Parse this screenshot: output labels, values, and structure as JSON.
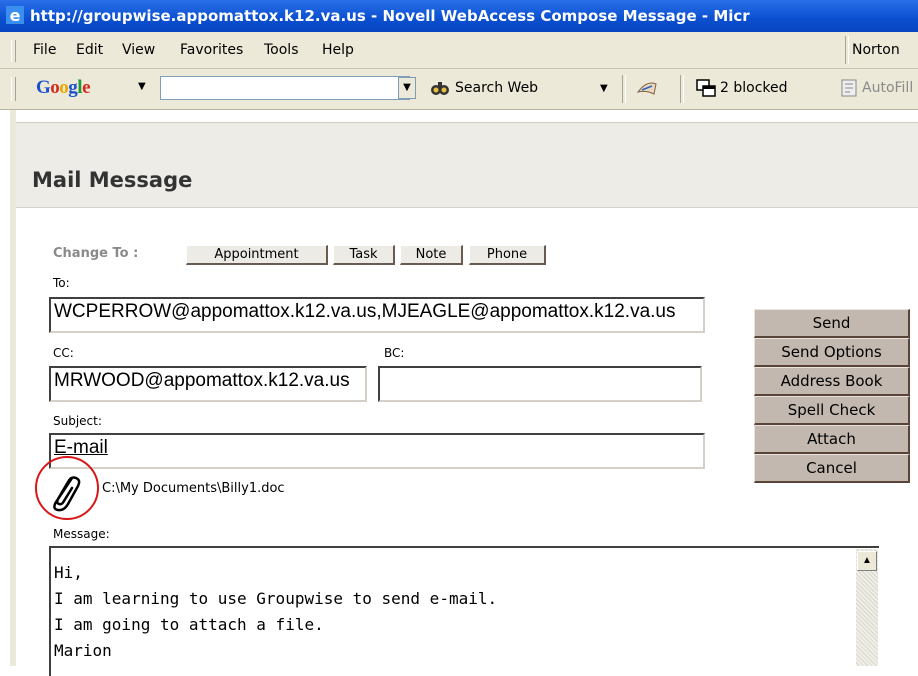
{
  "window": {
    "title": "http://groupwise.appomattox.k12.va.us - Novell WebAccess Compose Message - Micr"
  },
  "menu": {
    "items": [
      "File",
      "Edit",
      "View",
      "Favorites",
      "Tools",
      "Help"
    ],
    "norton": "Norton"
  },
  "google_toolbar": {
    "logo": [
      "G",
      "o",
      "o",
      "g",
      "l",
      "e"
    ],
    "search_value": "",
    "search_web": "Search Web",
    "popups_blocked": "2 blocked",
    "autofill": "AutoFill"
  },
  "page": {
    "title": "Mail Message",
    "change_to_label": "Change To :",
    "change_to_buttons": [
      "Appointment",
      "Task",
      "Note",
      "Phone"
    ]
  },
  "form": {
    "to_label": "To:",
    "to_value": "WCPERROW@appomattox.k12.va.us,MJEAGLE@appomattox.k12.va.us",
    "cc_label": "CC:",
    "cc_value": "MRWOOD@appomattox.k12.va.us",
    "bc_label": "BC:",
    "bc_value": "",
    "subject_label": "Subject:",
    "subject_value": "E-mail",
    "attachment_path": "C:\\My Documents\\Billy1.doc",
    "message_label": "Message:",
    "message_lines": [
      "Hi,",
      "I am learning to use Groupwise to send e-mail.",
      "I am going to attach a file.",
      "Marion"
    ]
  },
  "actions": [
    "Send",
    "Send Options",
    "Address Book",
    "Spell Check",
    "Attach",
    "Cancel"
  ],
  "colors": {
    "titlebar": "#0a4fd0",
    "action_button": "#c2b8b0",
    "highlight_ring": "#d81818"
  },
  "icons": {
    "browser": "ie-icon",
    "attachment": "paperclip-icon",
    "search": "binoculars-icon",
    "popup": "popup-blocker-icon"
  }
}
